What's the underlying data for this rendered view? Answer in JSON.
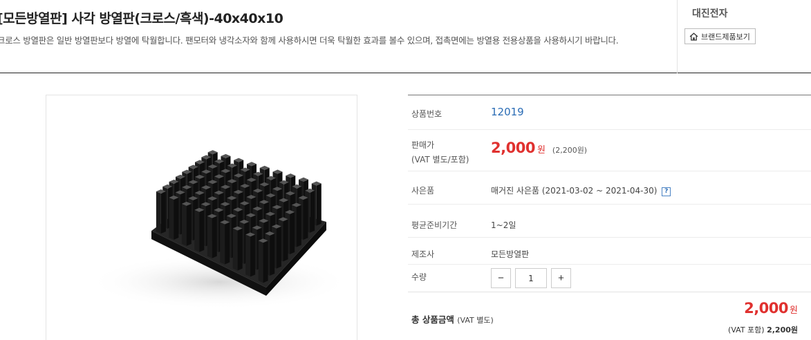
{
  "product": {
    "title": "[모든방열판] 사각 방열판(크로스/흑색)-40x40x10",
    "description": "크로스 방열판은 일반 방열판보다 방열에 탁월합니다. 팬모터와 냉각소자와 함께 사용하시면 더욱 탁월한 효과를 볼수 있으며, 접촉면에는 방열용 전용상품을 사용하시기 바랍니다."
  },
  "brand": {
    "name": "대진전자",
    "button_label": "브랜드제품보기",
    "button_icon": "home-icon"
  },
  "info": {
    "code_label": "상품번호",
    "code_value": "12019",
    "price_label_line1": "판매가",
    "price_label_line2": "(VAT 별도/포함)",
    "price_value": "2,000",
    "price_unit": "원",
    "price_vat": "(2,200원)",
    "gift_label": "사은품",
    "gift_value": "매거진 사은품 (2021-03-02 ~ 2021-04-30)",
    "gift_help_icon": "?",
    "prep_label": "평균준비기간",
    "prep_value": "1~2일",
    "maker_label": "제조사",
    "maker_value": "모든방열판",
    "qty_label": "수량",
    "qty_value": "1",
    "qty_minus": "−",
    "qty_plus": "+"
  },
  "total": {
    "label": "총 상품금액",
    "label_note": "(VAT 별도)",
    "value": "2,000",
    "unit": "원",
    "vat_label": "(VAT 포함)",
    "vat_value": "2,200원"
  },
  "colors": {
    "accent_red": "#e0312f",
    "link_blue": "#2a6cb5",
    "heatsink": "#1c1c1c"
  }
}
